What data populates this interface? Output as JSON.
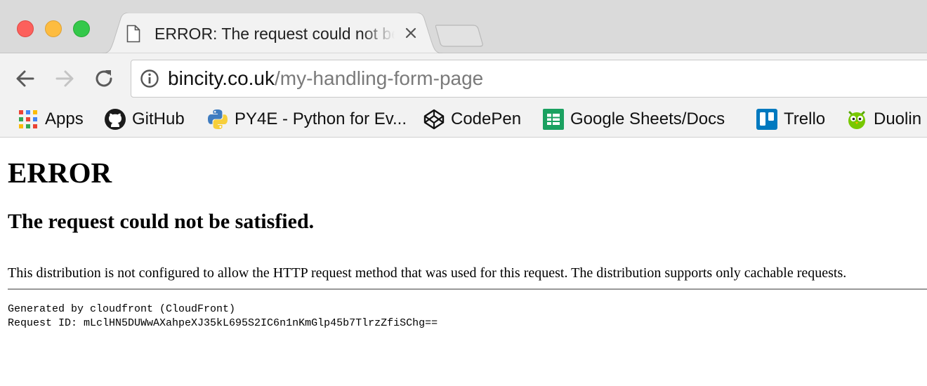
{
  "tab": {
    "title": "ERROR: The request could not be satisfied",
    "page_icon": "document-icon",
    "close_icon": "close-icon"
  },
  "toolbar": {
    "back_icon": "back-arrow-icon",
    "forward_icon": "forward-arrow-icon",
    "reload_icon": "reload-icon",
    "omnibox": {
      "info_icon": "info-icon",
      "host": "bincity.co.uk",
      "path": "/my-handling-form-page"
    }
  },
  "bookmarks": [
    {
      "label": "Apps",
      "icon": "apps-grid-icon"
    },
    {
      "label": "GitHub",
      "icon": "github-icon"
    },
    {
      "label": "PY4E - Python for Ev...",
      "icon": "python-icon"
    },
    {
      "label": "CodePen",
      "icon": "codepen-icon"
    },
    {
      "label": "Google Sheets/Docs",
      "icon": "google-sheets-icon"
    },
    {
      "label": "Trello",
      "icon": "trello-icon"
    },
    {
      "label": "Duolin",
      "icon": "duolingo-icon"
    }
  ],
  "page": {
    "heading": "ERROR",
    "subheading": "The request could not be satisfied.",
    "message": "This distribution is not configured to allow the HTTP request method that was used for this request. The distribution supports only cachable requests.",
    "generated_by": "Generated by cloudfront (CloudFront)",
    "request_id_line": "Request ID: mLclHN5DUWwAXahpeXJ35kL695S2IC6n1nKmGlp45b7TlrzZfiSChg=="
  }
}
